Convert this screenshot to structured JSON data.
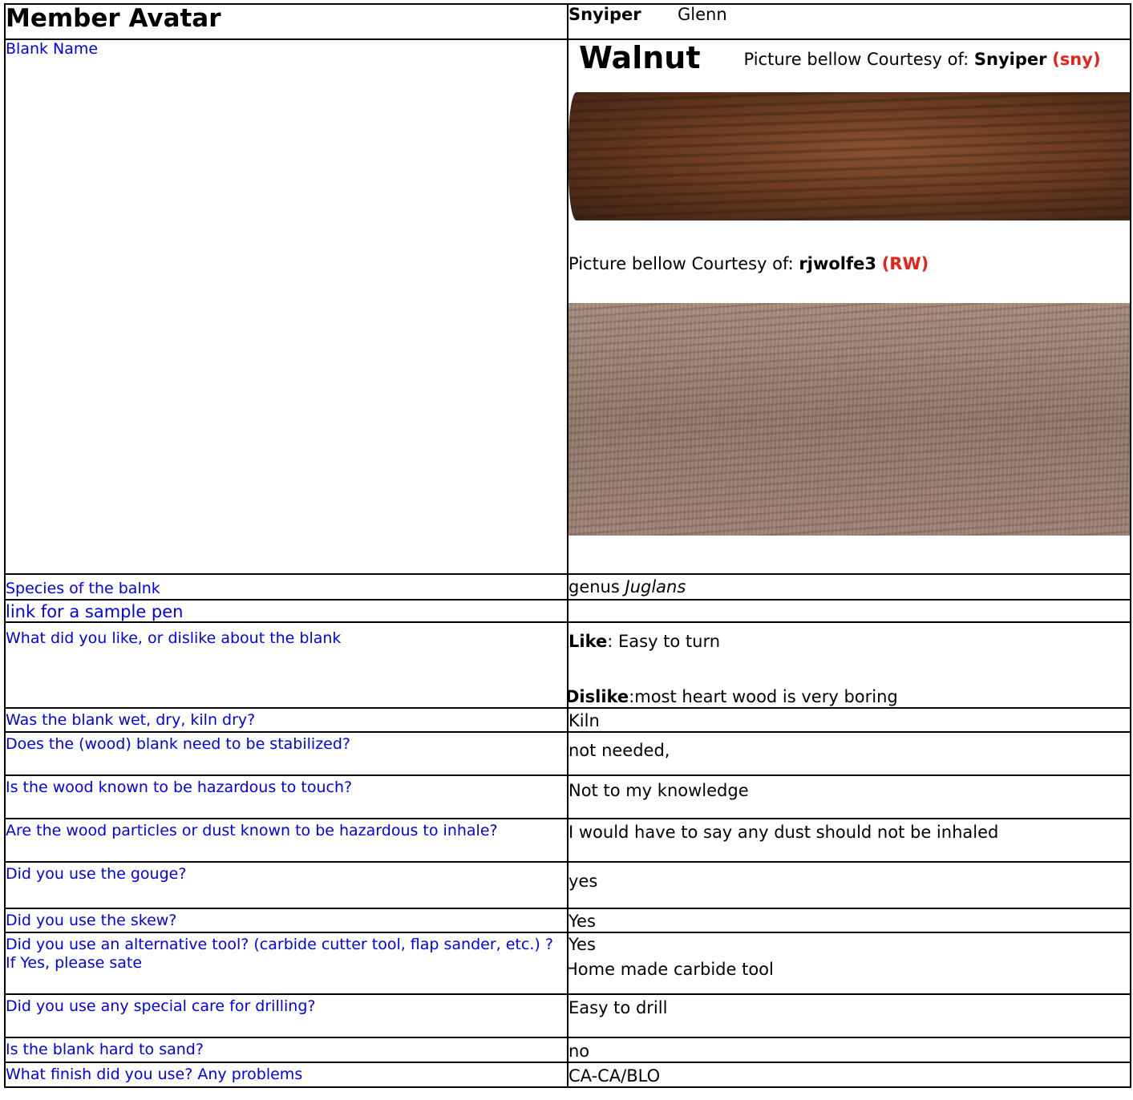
{
  "header": {
    "left": "Member Avatar",
    "username": "Snyiper",
    "realname": "Glenn"
  },
  "blank_name": {
    "label": "Blank Name",
    "title": "Walnut",
    "picture1": {
      "prefix": "Picture bellow Courtesy of: ",
      "member": "Snyiper",
      "tag": "(sny)"
    },
    "picture2": {
      "prefix": "Picture bellow Courtesy of: ",
      "member": "rjwolfe3",
      "tag": "(RW)"
    }
  },
  "rows": {
    "species": {
      "q": "Species of the balnk",
      "a_prefix": "genus ",
      "a_italic": "Juglans"
    },
    "link": {
      "q": "link for a sample pen",
      "a": ""
    },
    "like": {
      "q": "What did you like, or dislike about the blank",
      "like_label": "Like",
      "like_text": ": Easy to turn",
      "dislike_label": "Dislike",
      "dislike_text": ":most heart wood is very boring"
    },
    "wet": {
      "q": "Was the blank wet, dry, kiln dry?",
      "a": "Kiln"
    },
    "stabilized": {
      "q": "Does the (wood) blank need to be stabilized?",
      "a": "not needed,"
    },
    "touch": {
      "q": "Is the wood known to be hazardous to touch?",
      "a": "Not to my knowledge"
    },
    "inhale": {
      "q": "Are the wood particles or dust known to be hazardous to inhale?",
      "a": "I would have to say any dust should not be inhaled"
    },
    "gouge": {
      "q": "Did you use the gouge?",
      "a": "yes"
    },
    "skew": {
      "q": "Did you use the skew?",
      "a": "Yes"
    },
    "alt_tool": {
      "q": "Did you use an alternative tool? (carbide cutter tool, flap sander, etc.) ? If Yes, please sate",
      "a1": "Yes",
      "a2": "Home made carbide tool"
    },
    "drilling": {
      "q": "Did you use any special care for drilling?",
      "a": "Easy to drill"
    },
    "sand": {
      "q": "Is the blank hard to sand?",
      "a": "no"
    },
    "finish": {
      "q": "What finish did you use? Any problems",
      "a": "CA-CA/BLO"
    }
  }
}
